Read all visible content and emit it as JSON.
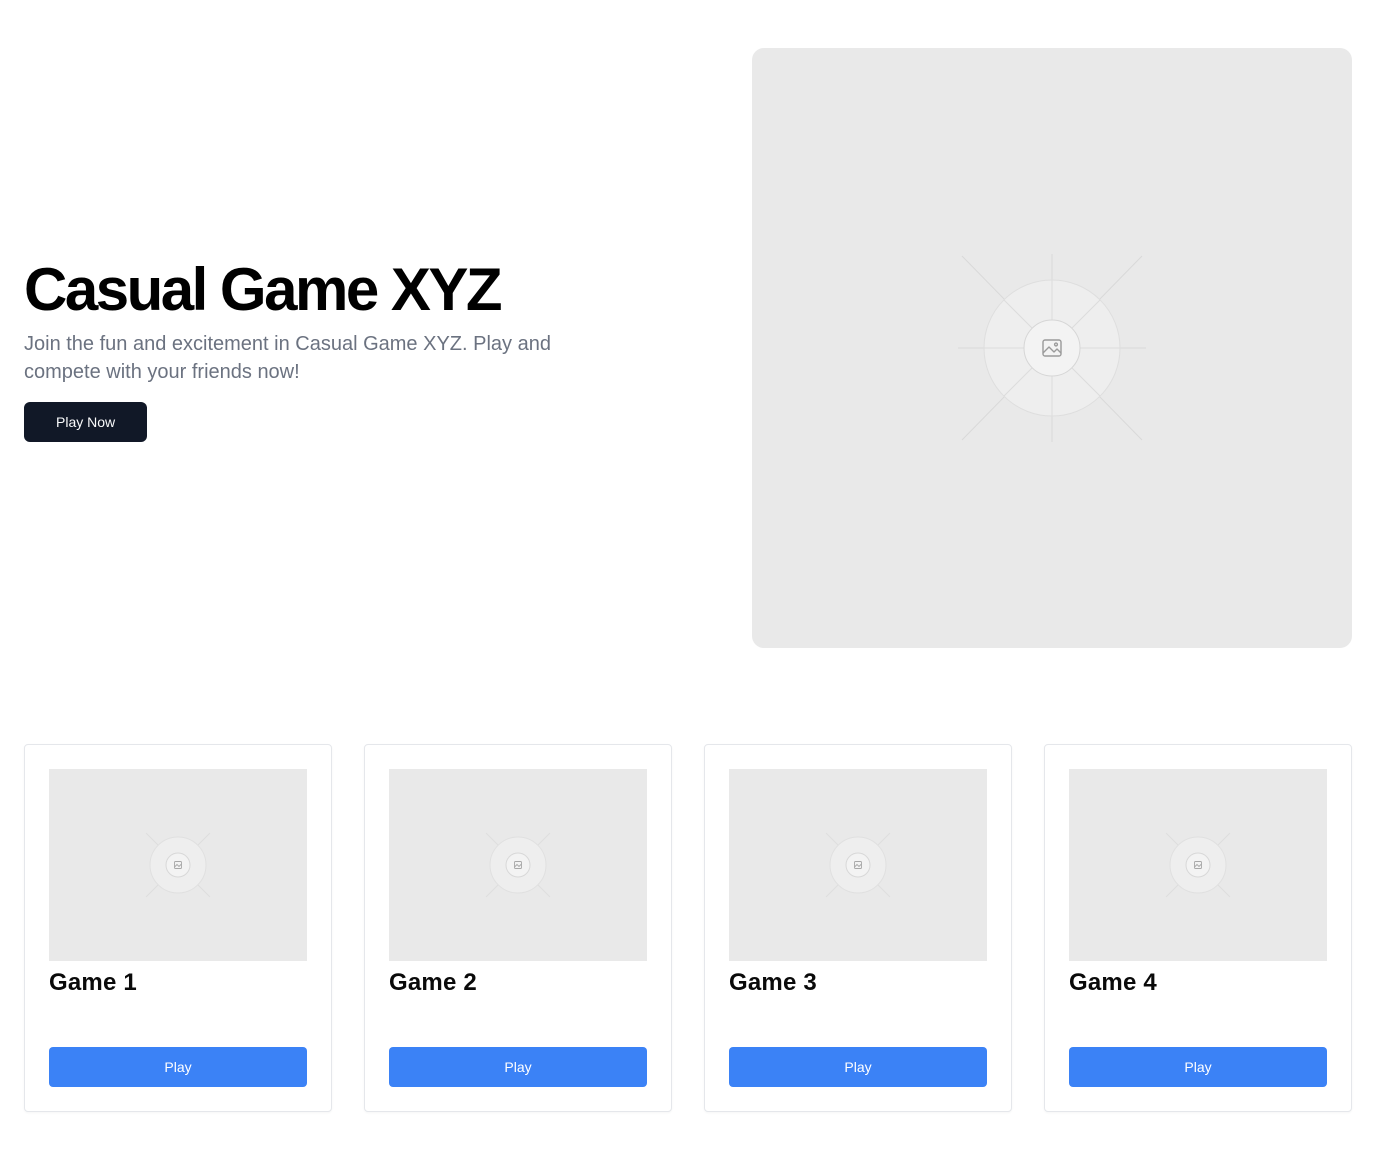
{
  "hero": {
    "title": "Casual Game XYZ",
    "description": "Join the fun and excitement in Casual Game XYZ. Play and compete with your friends now!",
    "cta_label": "Play Now",
    "image_icon": "image-placeholder-icon"
  },
  "games": [
    {
      "title": "Game 1",
      "button_label": "Play"
    },
    {
      "title": "Game 2",
      "button_label": "Play"
    },
    {
      "title": "Game 3",
      "button_label": "Play"
    },
    {
      "title": "Game 4",
      "button_label": "Play"
    }
  ],
  "colors": {
    "primary_dark": "#111827",
    "accent_blue": "#3b82f6",
    "muted_text": "#6b7280",
    "placeholder_bg": "#e9e9e9",
    "card_border": "#e5e7eb"
  }
}
